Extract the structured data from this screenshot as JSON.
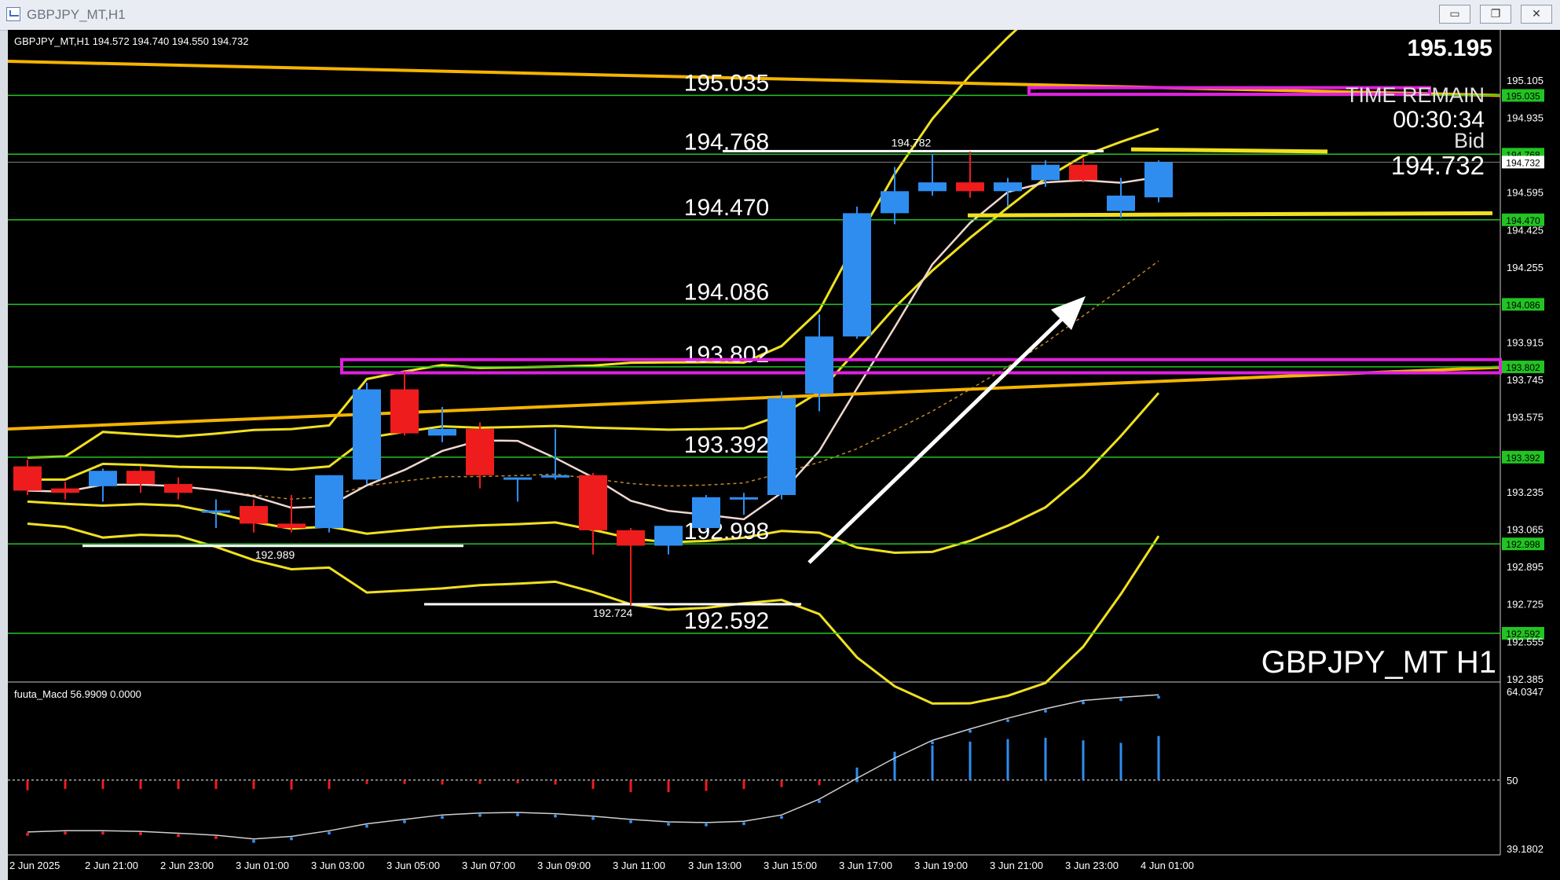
{
  "window": {
    "title": "GBPJPY_MT,H1",
    "buttons": [
      {
        "name": "minimize-button",
        "glyph": "▭"
      },
      {
        "name": "restore-button",
        "glyph": "❐"
      },
      {
        "name": "close-button",
        "glyph": "✕"
      }
    ]
  },
  "chart_header": {
    "info": "GBPJPY_MT,H1  194.572 194.740 194.550 194.732"
  },
  "overlay": {
    "price_top": "195.195",
    "time_remain_label": "TIME REMAIN",
    "time_remain_value": "00:30:34",
    "bid_label": "Bid",
    "bid_value": "194.732",
    "symbol_label": "GBPJPY_MT H1",
    "macd_label": "fuuta_Macd 56.9909  0.0000"
  },
  "colors": {
    "background": "#000000",
    "bull": "#2f8df0",
    "bear": "#ee1c1c",
    "level_line": "#22c422",
    "band": "#f0e020",
    "trend": "#f4b400",
    "zone": "#e020e0",
    "arrow": "#ffffff"
  },
  "chart_data": {
    "type": "candlestick",
    "symbol": "GBPJPY_MT",
    "timeframe": "H1",
    "ylim": [
      192.385,
      195.19
    ],
    "x_tick_labels": [
      "2 Jun 2025",
      "2 Jun 21:00",
      "2 Jun 23:00",
      "3 Jun 01:00",
      "3 Jun 03:00",
      "3 Jun 05:00",
      "3 Jun 07:00",
      "3 Jun 09:00",
      "3 Jun 11:00",
      "3 Jun 13:00",
      "3 Jun 15:00",
      "3 Jun 17:00",
      "3 Jun 19:00",
      "3 Jun 21:00",
      "3 Jun 23:00",
      "4 Jun 01:00"
    ],
    "y_tick_labels": [
      "195.105",
      "194.935",
      "194.595",
      "194.425",
      "194.255",
      "193.915",
      "193.745",
      "193.575",
      "193.235",
      "193.065",
      "192.895",
      "192.725",
      "192.555",
      "192.385"
    ],
    "level_lines": [
      195.035,
      194.768,
      194.47,
      194.086,
      193.802,
      193.392,
      192.998,
      192.592
    ],
    "level_labels": [
      "195.035",
      "194.768",
      "194.470",
      "194.086",
      "193.802",
      "193.392",
      "192.998",
      "192.592"
    ],
    "current_bid_label": "194.732",
    "high_low_labels": [
      {
        "label": "194.782",
        "value": 194.782
      },
      {
        "label": "192.989",
        "value": 192.989
      },
      {
        "label": "192.724",
        "value": 192.724
      }
    ],
    "candles": [
      {
        "o": 193.35,
        "h": 193.38,
        "l": 193.22,
        "c": 193.24
      },
      {
        "o": 193.25,
        "h": 193.28,
        "l": 193.2,
        "c": 193.23
      },
      {
        "o": 193.26,
        "h": 193.34,
        "l": 193.19,
        "c": 193.33
      },
      {
        "o": 193.33,
        "h": 193.35,
        "l": 193.23,
        "c": 193.27
      },
      {
        "o": 193.27,
        "h": 193.3,
        "l": 193.2,
        "c": 193.23
      },
      {
        "o": 193.15,
        "h": 193.2,
        "l": 193.07,
        "c": 193.15
      },
      {
        "o": 193.17,
        "h": 193.2,
        "l": 193.05,
        "c": 193.09
      },
      {
        "o": 193.09,
        "h": 193.22,
        "l": 193.05,
        "c": 193.07
      },
      {
        "o": 193.07,
        "h": 193.31,
        "l": 193.05,
        "c": 193.31
      },
      {
        "o": 193.29,
        "h": 193.73,
        "l": 193.27,
        "c": 193.7
      },
      {
        "o": 193.7,
        "h": 193.78,
        "l": 193.49,
        "c": 193.5
      },
      {
        "o": 193.49,
        "h": 193.62,
        "l": 193.46,
        "c": 193.52
      },
      {
        "o": 193.52,
        "h": 193.55,
        "l": 193.25,
        "c": 193.31
      },
      {
        "o": 193.29,
        "h": 193.3,
        "l": 193.19,
        "c": 193.3
      },
      {
        "o": 193.31,
        "h": 193.52,
        "l": 193.29,
        "c": 193.31
      },
      {
        "o": 193.31,
        "h": 193.32,
        "l": 192.95,
        "c": 193.06
      },
      {
        "o": 193.06,
        "h": 193.07,
        "l": 192.72,
        "c": 192.99
      },
      {
        "o": 192.99,
        "h": 193.06,
        "l": 192.95,
        "c": 193.08
      },
      {
        "o": 193.07,
        "h": 193.22,
        "l": 193.06,
        "c": 193.21
      },
      {
        "o": 193.2,
        "h": 193.23,
        "l": 193.13,
        "c": 193.21
      },
      {
        "o": 193.22,
        "h": 193.69,
        "l": 193.2,
        "c": 193.66
      },
      {
        "o": 193.68,
        "h": 194.04,
        "l": 193.6,
        "c": 193.94
      },
      {
        "o": 193.94,
        "h": 194.53,
        "l": 193.93,
        "c": 194.5
      },
      {
        "o": 194.5,
        "h": 194.71,
        "l": 194.45,
        "c": 194.6
      },
      {
        "o": 194.6,
        "h": 194.77,
        "l": 194.58,
        "c": 194.64
      },
      {
        "o": 194.64,
        "h": 194.78,
        "l": 194.57,
        "c": 194.6
      },
      {
        "o": 194.6,
        "h": 194.66,
        "l": 194.53,
        "c": 194.64
      },
      {
        "o": 194.65,
        "h": 194.74,
        "l": 194.62,
        "c": 194.72
      },
      {
        "o": 194.72,
        "h": 194.75,
        "l": 194.64,
        "c": 194.65
      },
      {
        "o": 194.51,
        "h": 194.66,
        "l": 194.48,
        "c": 194.58
      },
      {
        "o": 194.572,
        "h": 194.74,
        "l": 194.55,
        "c": 194.732
      }
    ],
    "macd_panel": {
      "label": "fuuta_Macd 56.9909  0.0000",
      "ylim": [
        39.1802,
        64.0347
      ],
      "y_tick_labels": [
        "64.0347",
        "50",
        "39.1802"
      ],
      "histogram": [
        48.4,
        48.6,
        48.6,
        48.6,
        48.6,
        48.6,
        48.6,
        48.5,
        48.6,
        49.4,
        49.4,
        49.3,
        49.4,
        49.5,
        49.3,
        48.6,
        48.1,
        48.1,
        48.3,
        48.6,
        48.9,
        49.2,
        52.0,
        54.5,
        55.5,
        56.1,
        56.5,
        56.7,
        56.3,
        55.9,
        56.9909
      ],
      "signal": [
        41.8,
        42.0,
        42.0,
        41.9,
        41.6,
        41.3,
        40.7,
        41.1,
        42.0,
        43.1,
        43.8,
        44.5,
        44.8,
        44.9,
        44.7,
        44.3,
        43.8,
        43.4,
        43.3,
        43.5,
        44.5,
        47.0,
        50.3,
        53.5,
        56.3,
        58.1,
        59.8,
        61.3,
        62.6,
        63.1,
        63.5
      ]
    }
  }
}
